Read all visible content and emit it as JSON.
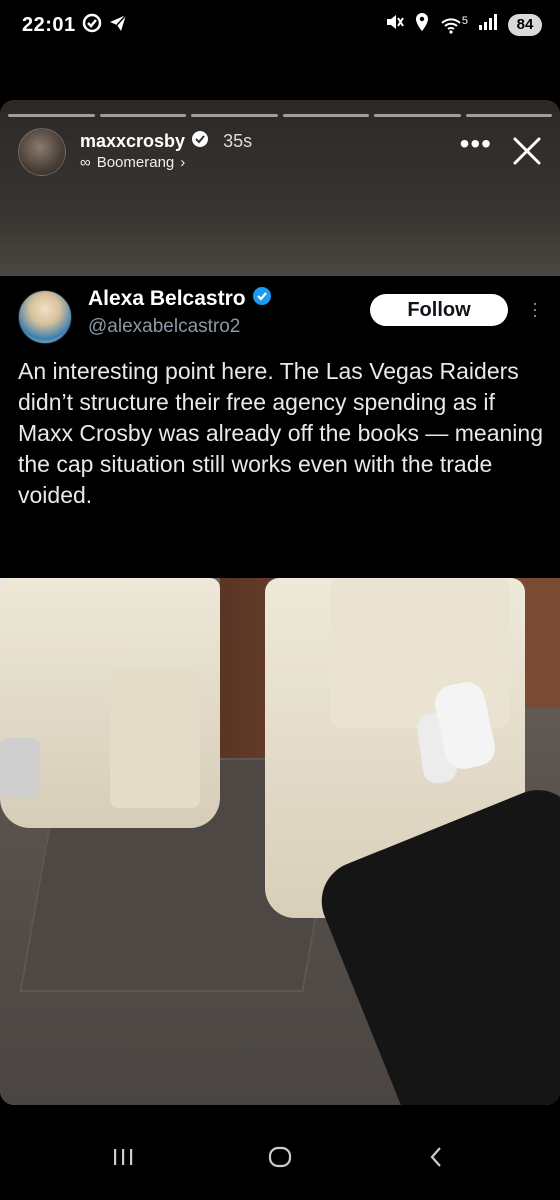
{
  "status_bar": {
    "time": "22:01",
    "network": "5",
    "battery": "84"
  },
  "story": {
    "username": "maxxcrosby",
    "time_ago": "35s",
    "boomerang_symbol": "∞",
    "boomerang_label": "Boomerang",
    "boomerang_chevron": "›",
    "more_symbol": "•••",
    "segments": 6
  },
  "tweet": {
    "author_name": "Alexa Belcastro",
    "handle": "@alexabelcastro2",
    "follow_label": "Follow",
    "body": "An interesting point here. The Las Vegas Raiders didn’t structure their free agency spending as if Maxx Crosby was already off the books — meaning the cap situation still works even with the trade voided."
  },
  "colors": {
    "verified": "#1d9bf0",
    "handle": "#8b98a5",
    "tweet_text": "#e7e9ea"
  },
  "icons": {
    "status_left": [
      "check-circle-icon",
      "telegram-icon"
    ],
    "status_right": [
      "mute-icon",
      "location-icon",
      "wifi-icon",
      "signal-icon"
    ],
    "nav": [
      "recents-icon",
      "home-icon",
      "back-icon"
    ]
  }
}
